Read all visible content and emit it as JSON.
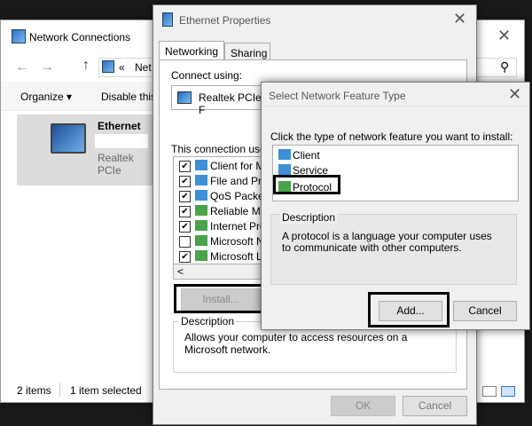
{
  "network_connections": {
    "title": "Network Connections",
    "address_prefix": "«",
    "address_text": "Net",
    "toolbar": {
      "organize": "Organize ▾",
      "disable": "Disable this"
    },
    "item": {
      "name": "Ethernet",
      "adapter": "Realtek PCIe"
    },
    "status": {
      "count": "2 items",
      "selected": "1 item selected"
    }
  },
  "ethernet_properties": {
    "title": "Ethernet Properties",
    "tabs": [
      "Networking",
      "Sharing"
    ],
    "connect_using_label": "Connect using:",
    "adapter_name": "Realtek PCIe F",
    "components_label": "This connection uses",
    "components": [
      {
        "label": "Client for Mic",
        "checked": "✔"
      },
      {
        "label": "File and Print",
        "checked": "✔"
      },
      {
        "label": "QoS Packet",
        "checked": "✔"
      },
      {
        "label": "Reliable Mult",
        "checked": "✔"
      },
      {
        "label": "Internet Proto",
        "checked": "✔"
      },
      {
        "label": "Microsoft Ne",
        "checked": ""
      },
      {
        "label": "Microsoft LLI",
        "checked": "✔"
      }
    ],
    "scroll_left": "<",
    "install_button": "Install...",
    "description_label": "Description",
    "description_text": "Allows your computer to access resources on a Microsoft network.",
    "ok_button": "OK",
    "cancel_button": "Cancel"
  },
  "select_feature": {
    "title": "Select Network Feature Type",
    "prompt": "Click the type of network feature you want to install:",
    "options": [
      "Client",
      "Service",
      "Protocol"
    ],
    "description_label": "Description",
    "description_text": "A protocol is a language your computer uses to communicate with other computers.",
    "add_button": "Add...",
    "cancel_button": "Cancel"
  },
  "icons": {
    "close": "✕",
    "back": "←",
    "forward": "→",
    "up": "↑",
    "search": "⚲"
  },
  "colors": {
    "selection_bg": "#dcdcdc",
    "dialog_bg": "#f0f0f0",
    "highlight_border": "#000000"
  }
}
